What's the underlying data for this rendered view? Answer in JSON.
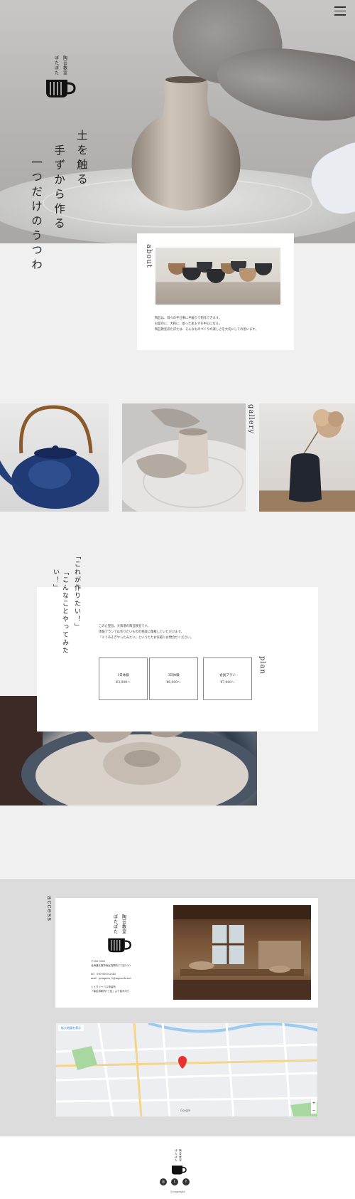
{
  "hero": {
    "logo": {
      "col1": "陶芸教室",
      "col2": "ぽたぽた"
    },
    "tagline": [
      "土を触る",
      "手ずから作る",
      "一つだけのうつわ"
    ]
  },
  "about": {
    "title": "about",
    "text": [
      "陶芸は、日々の手仕事に手触りで制作できます。",
      "お皿のに、大和に、並った主ますを中心になる。",
      "陶芸教室ぽたぽたは、そんなものづくりの楽しさを大切にしての思います。"
    ]
  },
  "gallery": {
    "title": "gallery"
  },
  "plan": {
    "quote": [
      "「これが作りたい！」",
      "「こんなことやってみたい！」"
    ],
    "title": "plan",
    "text": [
      "このた聖旨、大和港の陶芸教室です。",
      "体験プランでは作りたいものの相談に傷推していただけます。",
      "「ミうあそぎやったみたい」というたたお気軽にお問合せください。"
    ],
    "options": [
      {
        "name": "1日体験",
        "price": "¥3,000〜"
      },
      {
        "name": "3日体験",
        "price": "¥6,000〜"
      },
      {
        "name": "会員プラン",
        "price": "¥7,000〜"
      }
    ]
  },
  "access": {
    "title": "access",
    "logo": {
      "col1": "陶芸教室",
      "col2": "ぽたぽた"
    },
    "info": [
      "〒000-0000",
      "北海道札幌市南区真駒内7丁目2-20",
      "",
      "tel　090-0000-2345",
      "mail　potapota_C@mgouchi.net",
      "",
      "シュウリーバス停留所",
      "「南区真駒内7丁目」より徒歩5分"
    ]
  },
  "map": {
    "button": "拡大地図を表示",
    "google": "Google",
    "zoom_in": "+",
    "zoom_out": "−"
  },
  "footer": {
    "logo": {
      "col1": "陶芸教室",
      "col2": "ぽたぽた"
    },
    "social": [
      "instagram-icon",
      "twitter-icon",
      "facebook-icon"
    ],
    "social_glyphs": [
      "◎",
      "t",
      "f"
    ],
    "copyright": "©copyright"
  },
  "colors": {
    "text": "#333333",
    "background": "#f0f0f0",
    "card": "#ffffff",
    "map_pin": "#e8312f"
  }
}
